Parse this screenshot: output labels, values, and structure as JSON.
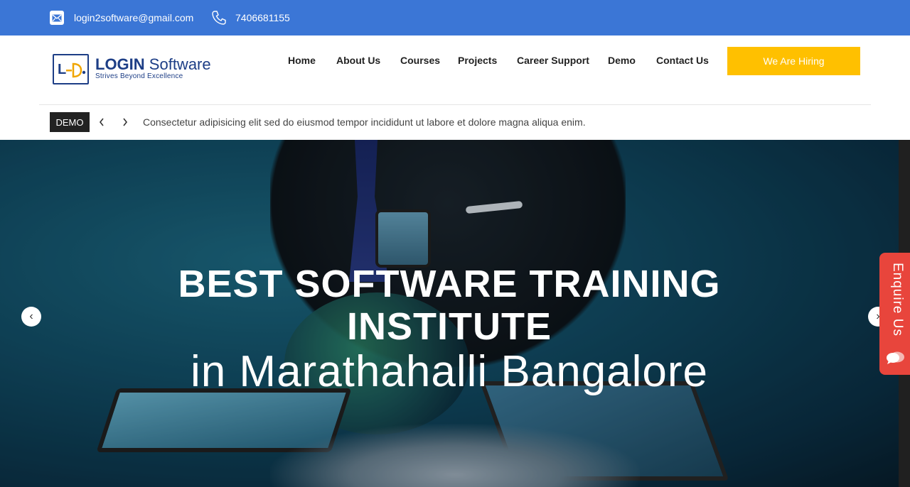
{
  "topbar": {
    "email": "login2software@gmail.com",
    "phone": "7406681155",
    "email_icon": "mail-icon",
    "phone_icon": "phone-icon",
    "bg_color": "#3b76d6"
  },
  "logo": {
    "brand_bold": "LOGIN",
    "brand_regular": "Software",
    "tagline": "Strives Beyond Excellence"
  },
  "nav": {
    "items": [
      {
        "label": "Home"
      },
      {
        "label": "About Us"
      },
      {
        "label": "Courses"
      },
      {
        "label": "Projects"
      },
      {
        "label": "Career Support"
      },
      {
        "label": "Demo"
      },
      {
        "label": "Contact Us"
      }
    ],
    "cta_label": "We Are Hiring",
    "cta_color": "#ffc000"
  },
  "ticker": {
    "tag": "DEMO",
    "prev_icon": "chevron-left-icon",
    "next_icon": "chevron-right-icon",
    "text": "Consectetur adipisicing elit sed do eiusmod tempor incididunt ut labore et dolore magna aliqua enim."
  },
  "hero": {
    "title_line1": "BEST SOFTWARE TRAINING",
    "title_line2": "INSTITUTE",
    "subtitle": "in Marathahalli Bangalore",
    "prev_label": "‹",
    "next_label": "›"
  },
  "enquire": {
    "label": "Enquire Us",
    "icon": "chat-bubble-icon",
    "color": "#e8453c"
  }
}
